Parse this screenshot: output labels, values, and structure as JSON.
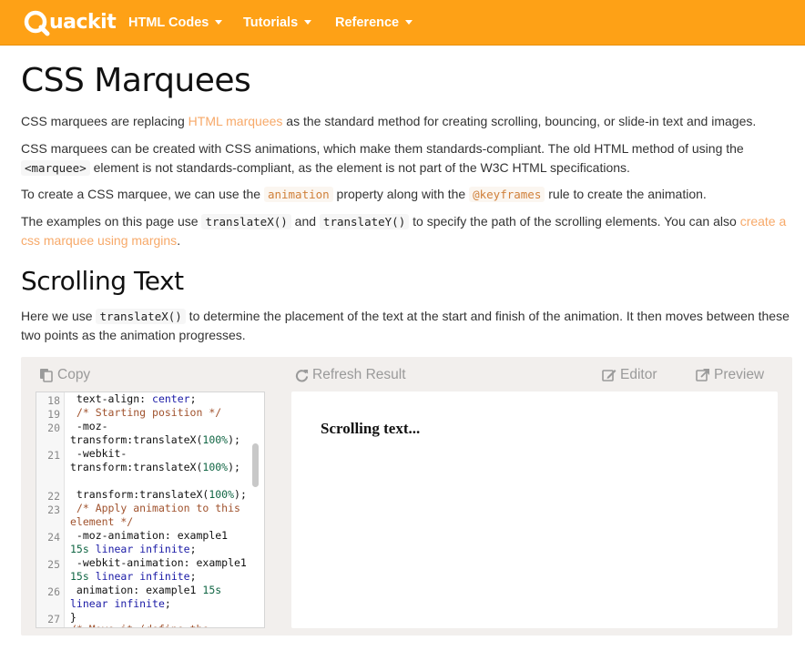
{
  "brand": {
    "logo_text": "uackit",
    "logo_letter": "Q"
  },
  "nav": {
    "items": [
      {
        "label": "HTML Codes"
      },
      {
        "label": "Tutorials"
      },
      {
        "label": "Reference"
      }
    ]
  },
  "page": {
    "title": "CSS Marquees",
    "p1": {
      "before": "CSS marquees are replacing ",
      "link": "HTML marquees",
      "after": " as the standard method for creating scrolling, bouncing, or slide-in text and images."
    },
    "p2": {
      "before": "CSS marquees can be created with CSS animations, which make them standards-compliant. The old HTML method of using the ",
      "code": "<marquee>",
      "after": " element is not standards-compliant, as the element is not part of the W3C HTML specifications."
    },
    "p3": {
      "before": "To create a CSS marquee, we can use the ",
      "code1": "animation",
      "middle": " property along with the ",
      "code2": "@keyframes",
      "after": " rule to create the animation."
    },
    "p4": {
      "before": "The examples on this page use ",
      "code1": "translateX()",
      "middle": " and ",
      "code2": "translateY()",
      "after": " to specify the path of the scrolling elements. You can also ",
      "link": "create a css marquee using margins",
      "end": "."
    },
    "section_title": "Scrolling Text",
    "p5": {
      "before": "Here we use ",
      "code": "translateX()",
      "after": " to determine the placement of the text at the start and finish of the animation. It then moves between these two points as the animation progresses."
    }
  },
  "example": {
    "toolbar": {
      "copy": "Copy",
      "refresh": "Refresh Result",
      "editor": "Editor",
      "preview": "Preview"
    },
    "line_numbers": [
      "18",
      "19",
      "20",
      "21",
      "22",
      "23",
      "24",
      "25",
      "26",
      "27"
    ],
    "result_text": "Scrolling text..."
  }
}
